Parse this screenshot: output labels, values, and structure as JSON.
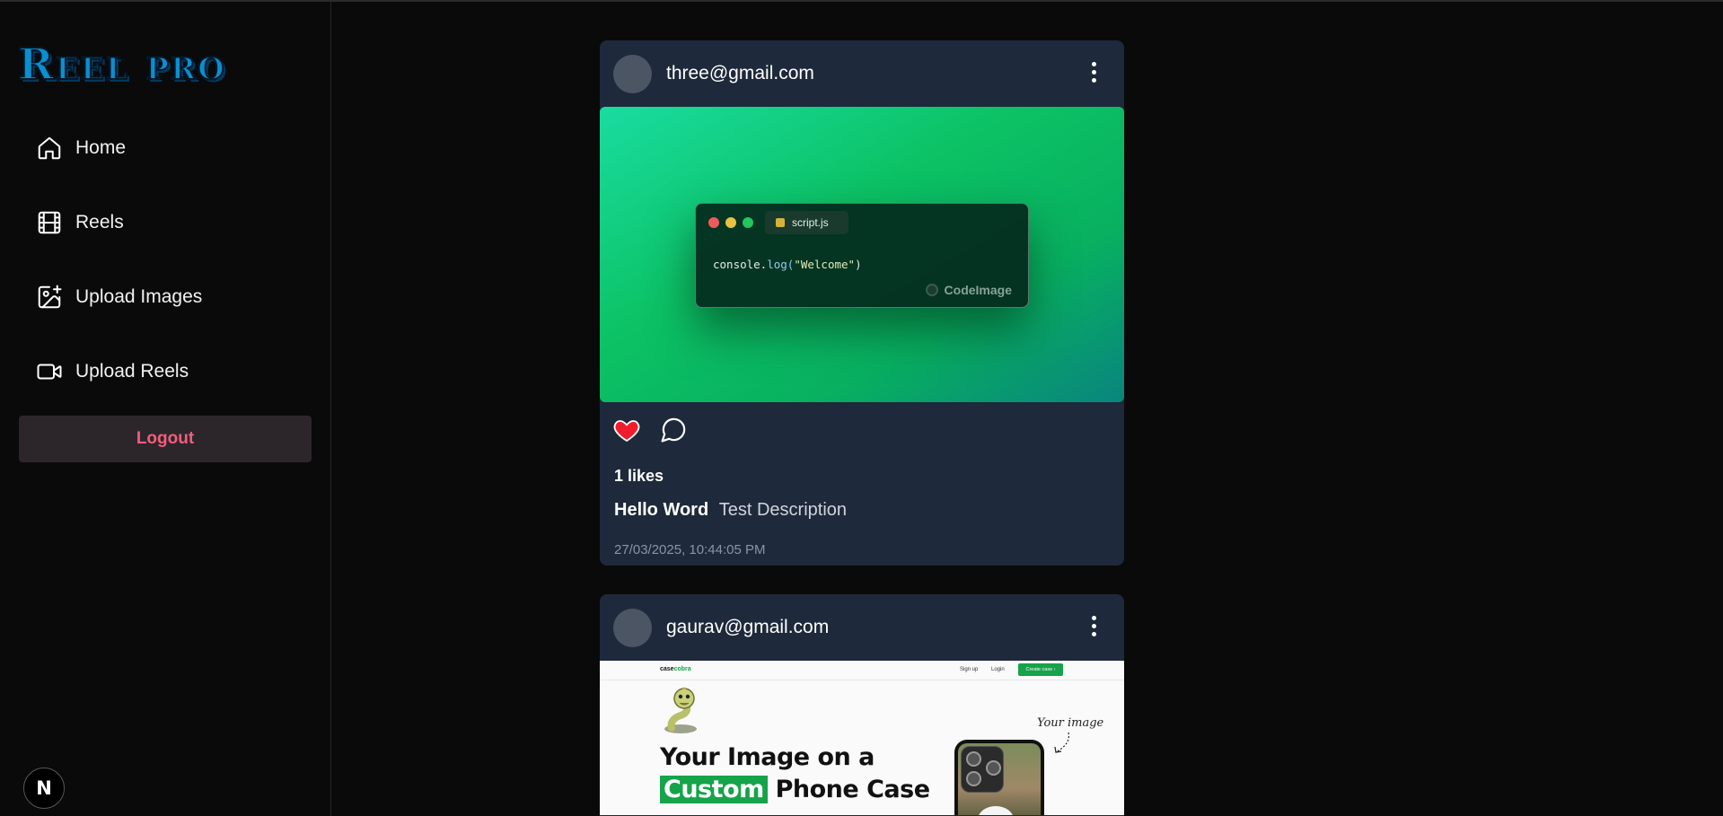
{
  "sidebar": {
    "logo": "Reel pro",
    "items": [
      {
        "label": "Home",
        "icon": "home-icon"
      },
      {
        "label": "Reels",
        "icon": "film-icon"
      },
      {
        "label": "Upload Images",
        "icon": "image-plus-icon"
      },
      {
        "label": "Upload Reels",
        "icon": "video-icon"
      }
    ],
    "logout_label": "Logout",
    "badge": "N"
  },
  "posts": [
    {
      "user": "three@gmail.com",
      "image": {
        "tab_name": "script.js",
        "code_obj": "console.",
        "code_fn": "log(",
        "code_str": "\"Welcome\"",
        "code_end": ")",
        "brand": "CodeImage"
      },
      "likes": "1 likes",
      "title": "Hello Word",
      "description": "Test Description",
      "timestamp": "27/03/2025, 10:44:05 PM",
      "liked": true
    },
    {
      "user": "gaurav@gmail.com",
      "image": {
        "site_logo_a": "case",
        "site_logo_b": "cobra",
        "nav_signup": "Sign up",
        "nav_login": "Login",
        "nav_cta": "Create case",
        "headline_1": "Your Image on a",
        "headline_highlight": "Custom",
        "headline_2": "Phone Case",
        "annotation": "Your image"
      }
    }
  ],
  "colors": {
    "accent_logout": "#f45d7c",
    "card_bg": "#1e293b",
    "like_red": "#ef1d2c",
    "cta_green": "#16a34a"
  }
}
